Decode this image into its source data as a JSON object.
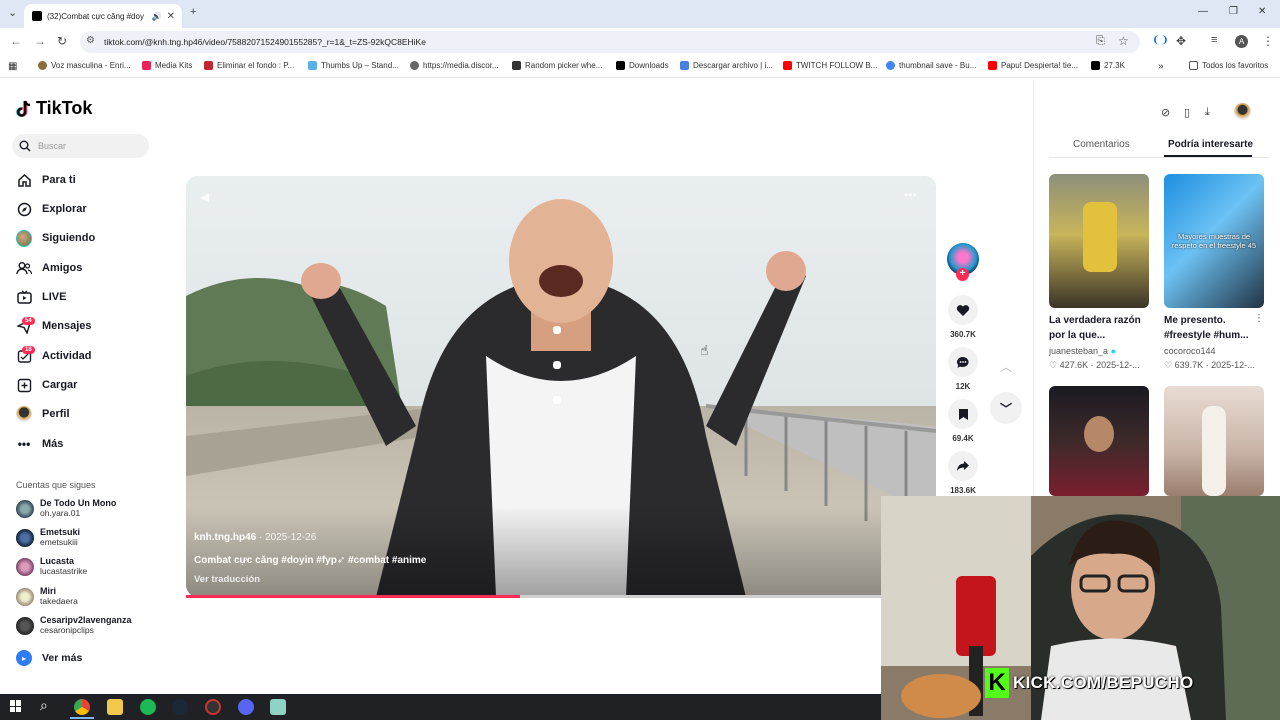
{
  "browser": {
    "tab_title": "(32)Combat cực căng #doy",
    "new_tab": "+",
    "url": "tiktok.com/@knh.tng.hp46/video/7588207152490155285?_r=1&_t=ZS-92kQC8EHiKe",
    "bookmarks": [
      "Voz masculina - Enri...",
      "Media Kits",
      "Eliminar el fondo : P...",
      "Thumbs Up – Stand...",
      "https://media.discor...",
      "Random picker whe...",
      "Downloads",
      "Descargar archivo | i...",
      "TWITCH FOLLOW B...",
      "thumbnail save - Bu...",
      "Papu! Despierta! tie...",
      "27.3K",
      "Todos los favoritos"
    ]
  },
  "tiktok": {
    "logo": "TikTok",
    "search_placeholder": "Buscar",
    "nav": [
      {
        "label": "Para ti",
        "icon": "home-icon"
      },
      {
        "label": "Explorar",
        "icon": "compass-icon"
      },
      {
        "label": "Siguiendo",
        "icon": "avatar-icon"
      },
      {
        "label": "Amigos",
        "icon": "friends-icon"
      },
      {
        "label": "LIVE",
        "icon": "live-icon"
      },
      {
        "label": "Mensajes",
        "icon": "message-icon",
        "badge": "54"
      },
      {
        "label": "Actividad",
        "icon": "bell-icon",
        "badge": "18"
      },
      {
        "label": "Cargar",
        "icon": "upload-icon"
      },
      {
        "label": "Perfil",
        "icon": "profile-icon"
      },
      {
        "label": "Más",
        "icon": "more-icon"
      }
    ],
    "following_header": "Cuentas que sigues",
    "following": [
      {
        "name": "De Todo Un Mono",
        "user": "oh.yara.01"
      },
      {
        "name": "Emetsuki",
        "user": "emetsukiii"
      },
      {
        "name": "Lucasta",
        "user": "lucastastrike"
      },
      {
        "name": "Miri",
        "user": "takedaera"
      },
      {
        "name": "Cesaripv2lavenganza",
        "user": "cesaronipclips"
      }
    ],
    "see_more": "Ver más"
  },
  "video": {
    "author": "knh.tng.hp46",
    "date": "2025-12-26",
    "caption": "Combat cực căng #doyin #fyp➶ #combat #anime",
    "translate": "Ver traducción",
    "progress": 0.445,
    "likes": "360.7K",
    "comments": "12K",
    "saves": "69.4K",
    "shares": "183.6K"
  },
  "panel": {
    "tab_comments": "Comentarios",
    "tab_suggested": "Podría interesarte",
    "cards": [
      {
        "title": "La verdadera razón por la que...",
        "user": "juanesteban_a",
        "likes": "427.6K",
        "date": "2025-12-..."
      },
      {
        "title": "Me presento. #freestyle #hum...",
        "user": "cocoroco144",
        "likes": "639.7K",
        "date": "2025-12-...",
        "overlay": "Mayores muestras de respeto en el freestyle 45"
      },
      {
        "title": "",
        "user": "",
        "likes": "",
        "date": ""
      },
      {
        "title": "",
        "user": "",
        "likes": "",
        "date": ""
      }
    ]
  },
  "stream": {
    "kick_text": "KICK.COM/BEPUCHO",
    "kick_letter": "K"
  },
  "colors": {
    "accent": "#fe2c55",
    "kick": "#53fc18"
  }
}
